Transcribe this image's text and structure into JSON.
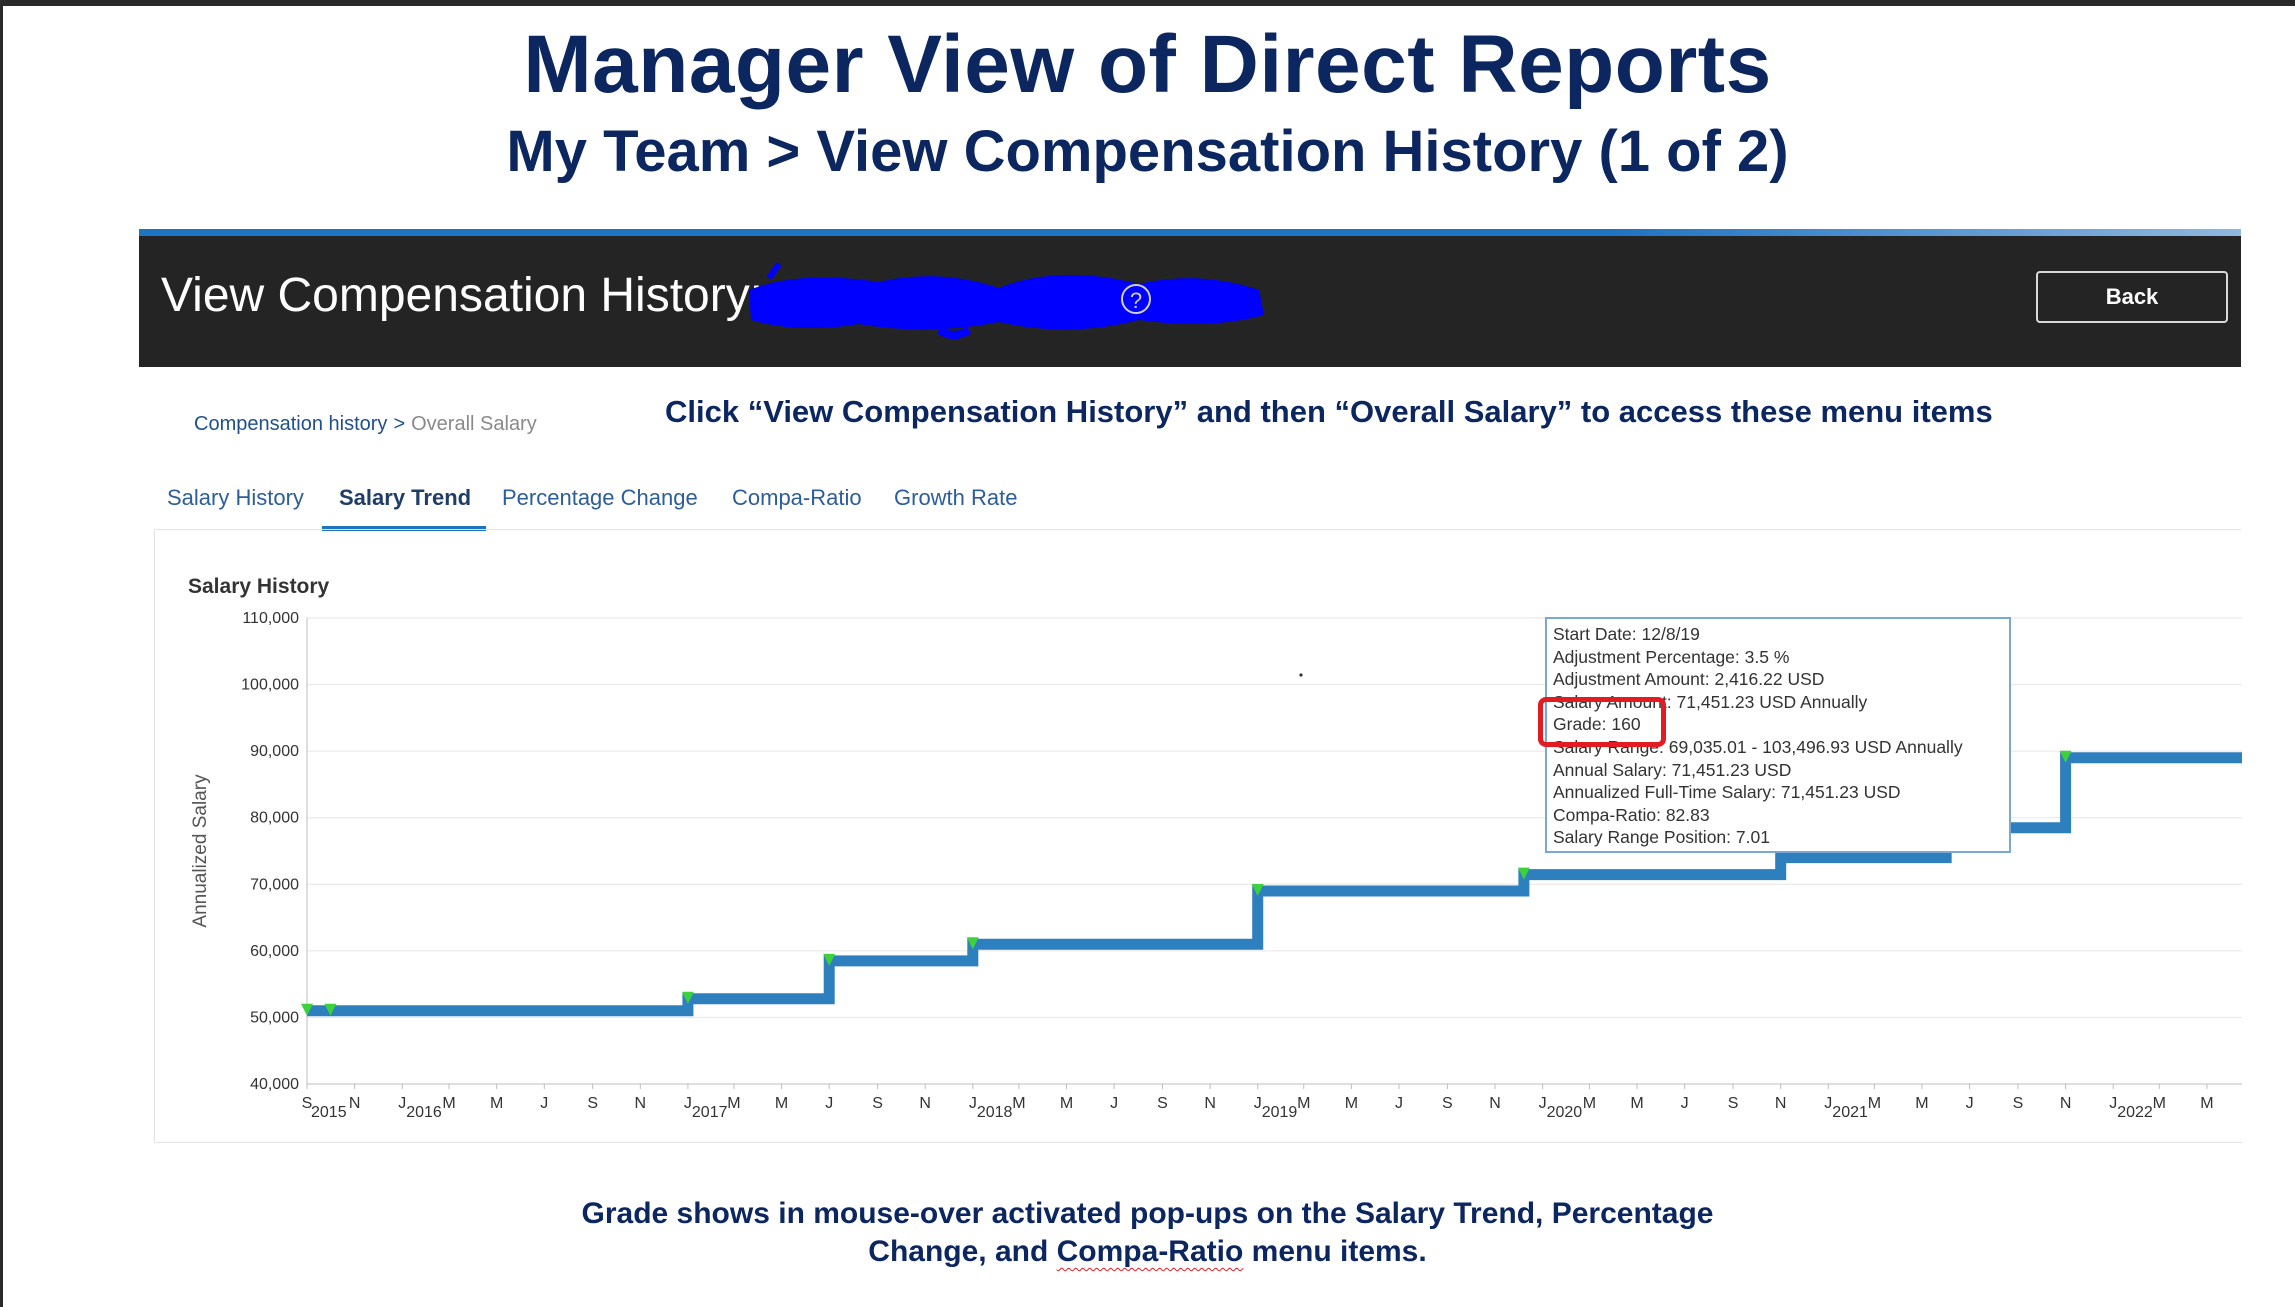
{
  "slide": {
    "title": "Manager View of Direct Reports",
    "subtitle": "My Team > View Compensation History (1 of 2)",
    "callout": "Click “View Compensation History” and then “Overall Salary” to access these menu items",
    "footer_line1": "Grade shows in mouse-over activated pop-ups on the Salary Trend, Percentage",
    "footer_line2_a": "Change, and ",
    "footer_line2_b": "Compa-Ratio",
    "footer_line2_c": " menu items."
  },
  "header": {
    "title": "View Compensation History:",
    "help_icon": "?",
    "back_label": "Back",
    "redaction_color": "#0000ff"
  },
  "breadcrumb": {
    "link": "Compensation history",
    "separator": ">",
    "current": "Overall Salary"
  },
  "tabs": [
    {
      "label": "Salary History",
      "active": false
    },
    {
      "label": "Salary Trend",
      "active": true
    },
    {
      "label": "Percentage Change",
      "active": false
    },
    {
      "label": "Compa-Ratio",
      "active": false
    },
    {
      "label": "Growth Rate",
      "active": false
    }
  ],
  "tooltip": {
    "rows": [
      "Start Date: 12/8/19",
      "Adjustment Percentage: 3.5 %",
      "Adjustment Amount: 2,416.22 USD",
      "Salary Amount: 71,451.23 USD Annually",
      "Grade: 160",
      "Salary Range: 69,035.01 - 103,496.93 USD Annually",
      "Annual Salary: 71,451.23 USD",
      "Annualized Full-Time Salary: 71,451.23 USD",
      "Compa-Ratio: 82.83",
      "Salary Range Position: 7.01"
    ]
  },
  "chart_data": {
    "type": "line",
    "title": "Salary History",
    "ylabel": "Annualized Salary",
    "xlabel": "",
    "step": true,
    "ylim": [
      40000,
      110000
    ],
    "yticks": [
      40000,
      50000,
      60000,
      70000,
      80000,
      90000,
      100000,
      110000
    ],
    "ytick_labels": [
      "40,000",
      "50,000",
      "60,000",
      "70,000",
      "80,000",
      "90,000",
      "100,000",
      "110,000"
    ],
    "xlim": [
      "2015-09-01",
      "2022-06-15"
    ],
    "xticks": [
      {
        "date": "2015-09-01",
        "label": "S"
      },
      {
        "date": "2015-11-01",
        "label": "N"
      },
      {
        "date": "2016-01-01",
        "label": "J"
      },
      {
        "date": "2016-03-01",
        "label": "M"
      },
      {
        "date": "2016-05-01",
        "label": "M"
      },
      {
        "date": "2016-07-01",
        "label": "J"
      },
      {
        "date": "2016-09-01",
        "label": "S"
      },
      {
        "date": "2016-11-01",
        "label": "N"
      },
      {
        "date": "2017-01-01",
        "label": "J"
      },
      {
        "date": "2017-03-01",
        "label": "M"
      },
      {
        "date": "2017-05-01",
        "label": "M"
      },
      {
        "date": "2017-07-01",
        "label": "J"
      },
      {
        "date": "2017-09-01",
        "label": "S"
      },
      {
        "date": "2017-11-01",
        "label": "N"
      },
      {
        "date": "2018-01-01",
        "label": "J"
      },
      {
        "date": "2018-03-01",
        "label": "M"
      },
      {
        "date": "2018-05-01",
        "label": "M"
      },
      {
        "date": "2018-07-01",
        "label": "J"
      },
      {
        "date": "2018-09-01",
        "label": "S"
      },
      {
        "date": "2018-11-01",
        "label": "N"
      },
      {
        "date": "2019-01-01",
        "label": "J"
      },
      {
        "date": "2019-03-01",
        "label": "M"
      },
      {
        "date": "2019-05-01",
        "label": "M"
      },
      {
        "date": "2019-07-01",
        "label": "J"
      },
      {
        "date": "2019-09-01",
        "label": "S"
      },
      {
        "date": "2019-11-01",
        "label": "N"
      },
      {
        "date": "2020-01-01",
        "label": "J"
      },
      {
        "date": "2020-03-01",
        "label": "M"
      },
      {
        "date": "2020-05-01",
        "label": "M"
      },
      {
        "date": "2020-07-01",
        "label": "J"
      },
      {
        "date": "2020-09-01",
        "label": "S"
      },
      {
        "date": "2020-11-01",
        "label": "N"
      },
      {
        "date": "2021-01-01",
        "label": "J"
      },
      {
        "date": "2021-03-01",
        "label": "M"
      },
      {
        "date": "2021-05-01",
        "label": "M"
      },
      {
        "date": "2021-07-01",
        "label": "J"
      },
      {
        "date": "2021-09-01",
        "label": "S"
      },
      {
        "date": "2021-11-01",
        "label": "N"
      },
      {
        "date": "2022-01-01",
        "label": "J"
      },
      {
        "date": "2022-03-01",
        "label": "M"
      },
      {
        "date": "2022-05-01",
        "label": "M"
      }
    ],
    "year_labels": [
      {
        "date": "2015-09-01",
        "label": "2015"
      },
      {
        "date": "2016-01-01",
        "label": "2016"
      },
      {
        "date": "2017-01-01",
        "label": "2017"
      },
      {
        "date": "2018-01-01",
        "label": "2018"
      },
      {
        "date": "2019-01-01",
        "label": "2019"
      },
      {
        "date": "2020-01-01",
        "label": "2020"
      },
      {
        "date": "2021-01-01",
        "label": "2021"
      },
      {
        "date": "2022-01-01",
        "label": "2022"
      }
    ],
    "series": [
      {
        "color": "#2e7fbd",
        "marker_color": "#3ed13e",
        "points": [
          {
            "x": "2015-09-01",
            "y": 51000
          },
          {
            "x": "2015-10-01",
            "y": 51000
          },
          {
            "x": "2017-01-01",
            "y": 52800
          },
          {
            "x": "2017-07-01",
            "y": 58500
          },
          {
            "x": "2018-01-01",
            "y": 61000
          },
          {
            "x": "2019-01-01",
            "y": 69000
          },
          {
            "x": "2019-12-08",
            "y": 71451
          },
          {
            "x": "2021-11-01",
            "y": 89000
          }
        ],
        "extra_steps": [
          {
            "x": "2020-11-01",
            "y": 74000
          },
          {
            "x": "2021-06-01",
            "y": 78500
          }
        ]
      }
    ],
    "grid": true,
    "legend": "none"
  }
}
